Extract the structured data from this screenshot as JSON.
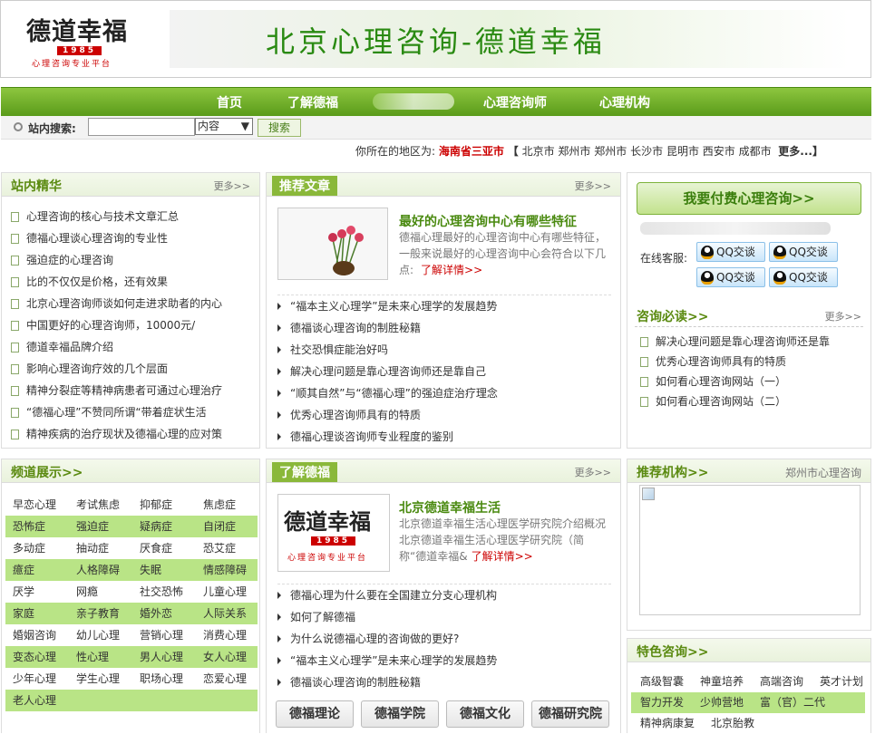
{
  "header": {
    "logo_text": "德道幸福",
    "logo_year": "1985",
    "logo_sub": "心理咨询专业平台",
    "banner": "北京心理咨询-德道幸福"
  },
  "nav": {
    "items": [
      "首页",
      "了解德福",
      "心理咨询师",
      "心理机构"
    ]
  },
  "search": {
    "label": "站内搜索:",
    "value": "",
    "select": "内容",
    "button": "搜索"
  },
  "region": {
    "prefix": "你所在的地区为:",
    "current": "海南省三亚市",
    "bracket_open": "【",
    "cities": [
      "北京市",
      "郑州市",
      "郑州市",
      "长沙市",
      "昆明市",
      "西安市",
      "成都市"
    ],
    "more": "更多...】"
  },
  "jinghua": {
    "title": "站内精华",
    "more": "更多>>",
    "items": [
      "心理咨询的核心与技术文章汇总",
      "德福心理谈心理咨询的专业性",
      "强迫症的心理咨询",
      "比的不仅仅是价格，还有效果",
      "北京心理咨询师谈如何走进求助者的内心",
      "中国更好的心理咨询师，10000元/",
      "德道幸福品牌介绍",
      "影响心理咨询疗效的几个层面",
      "精神分裂症等精神病患者可通过心理治疗",
      "“德福心理”不赞同所谓“带着症状生活",
      "精神疾病的治疗现状及德福心理的应对策"
    ]
  },
  "tuijian": {
    "title": "推荐文章",
    "more": "更多>>",
    "feat_title": "最好的心理咨询中心有哪些特征",
    "feat_text": "德福心理最好的心理咨询中心有哪些特征，一般来说最好的心理咨询中心会符合以下几点:",
    "readmore": "了解详情>>",
    "items": [
      "“福本主义心理学”是未来心理学的发展趋势",
      "德福谈心理咨询的制胜秘籍",
      "社交恐惧症能治好吗",
      "解决心理问题是靠心理咨询师还是靠自己",
      "“顺其自然”与“德福心理”的强迫症治疗理念",
      "优秀心理咨询师具有的特质",
      "德福心理谈咨询师专业程度的鉴别"
    ]
  },
  "right": {
    "pay_button": "我要付费心理咨询>>",
    "online_label": "在线客服:",
    "qq_label": "QQ交谈",
    "bidu_title": "咨询必读>>",
    "bidu_more": "更多>>",
    "bidu_items": [
      "解决心理问题是靠心理咨询师还是靠",
      "优秀心理咨询师具有的特质",
      "如何看心理咨询网站（一）",
      "如何看心理咨询网站（二）"
    ]
  },
  "pindao": {
    "title": "频道展示>>",
    "rows": [
      [
        "早恋心理",
        "考试焦虑",
        "抑郁症",
        "焦虑症"
      ],
      [
        "恐怖症",
        "强迫症",
        "疑病症",
        "自闭症"
      ],
      [
        "多动症",
        "抽动症",
        "厌食症",
        "恐艾症"
      ],
      [
        "癔症",
        "人格障碍",
        "失眠",
        "情感障碍"
      ],
      [
        "厌学",
        "网瘾",
        "社交恐怖",
        "儿童心理"
      ],
      [
        "家庭",
        "亲子教育",
        "婚外恋",
        "人际关系"
      ],
      [
        "婚姻咨询",
        "幼儿心理",
        "营销心理",
        "消费心理"
      ],
      [
        "变态心理",
        "性心理",
        "男人心理",
        "女人心理"
      ],
      [
        "少年心理",
        "学生心理",
        "职场心理",
        "恋爱心理"
      ],
      [
        "老人心理"
      ]
    ]
  },
  "liaojie": {
    "title": "了解德福",
    "more": "更多>>",
    "feat_title": "北京德道幸福生活",
    "feat_text": "北京德道幸福生活心理医学研究院介绍概况 北京德道幸福生活心理医学研究院（简称“德道幸福&",
    "readmore": "了解详情>>",
    "items": [
      "德福心理为什么要在全国建立分支心理机构",
      "如何了解德福",
      "为什么说德福心理的咨询做的更好?",
      "“福本主义心理学”是未来心理学的发展趋势",
      "德福谈心理咨询的制胜秘籍"
    ],
    "buttons": [
      "德福理论",
      "德福学院",
      "德福文化",
      "德福研究院"
    ]
  },
  "jigou": {
    "title": "推荐机构>>",
    "city": "郑州市心理咨询"
  },
  "tese": {
    "title": "特色咨询>>",
    "rows": [
      [
        "高级智囊",
        "神童培养",
        "高端咨询",
        "英才计划"
      ],
      [
        "智力开发",
        "少帅营地",
        "富（官）二代"
      ],
      [
        "精神病康复",
        "北京胎教"
      ]
    ]
  },
  "colors": {
    "accent": "#5a9b1a",
    "link_red": "#cc0000",
    "title_green": "#4a8a10"
  }
}
